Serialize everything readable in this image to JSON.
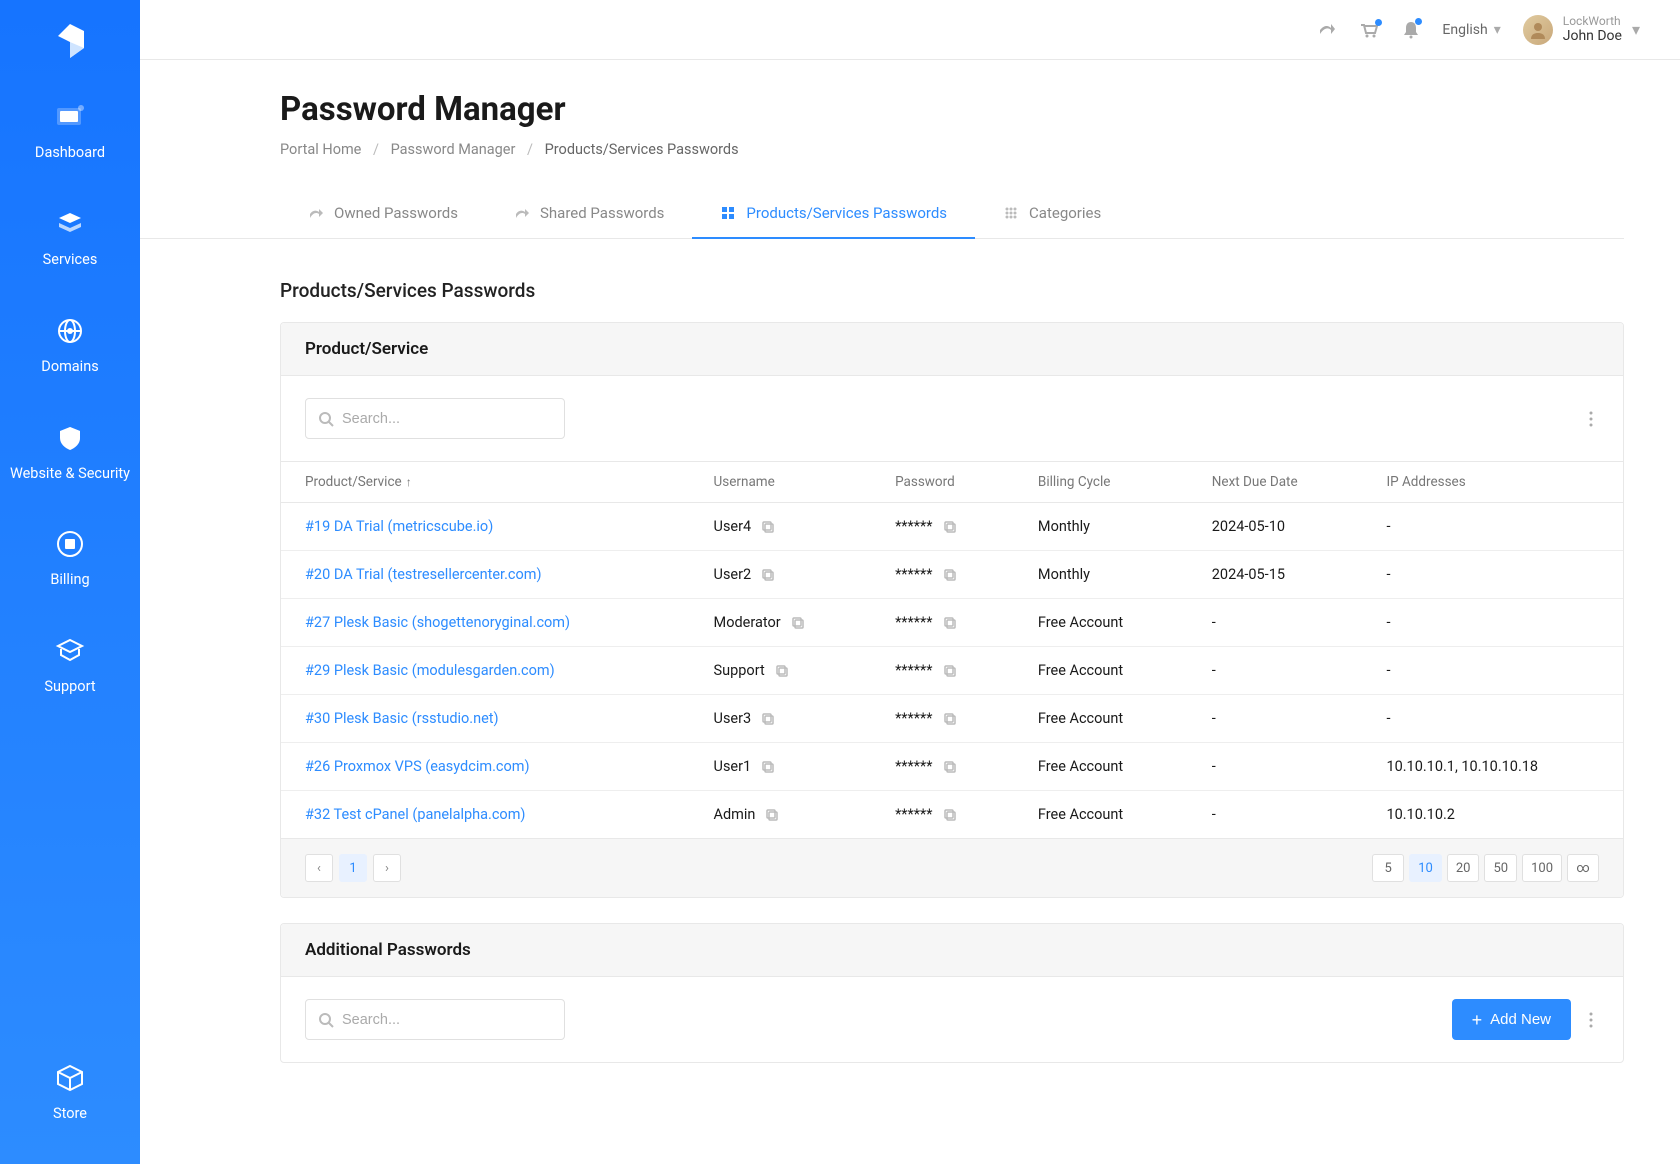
{
  "header": {
    "language": "English",
    "user": {
      "org": "LockWorth",
      "name": "John Doe"
    }
  },
  "sidebar": {
    "items": [
      {
        "label": "Dashboard"
      },
      {
        "label": "Services"
      },
      {
        "label": "Domains"
      },
      {
        "label": "Website & Security"
      },
      {
        "label": "Billing"
      },
      {
        "label": "Support"
      }
    ],
    "store": {
      "label": "Store"
    }
  },
  "page": {
    "title": "Password Manager",
    "breadcrumb": {
      "home": "Portal Home",
      "mid": "Password Manager",
      "current": "Products/Services Passwords"
    },
    "section_title": "Products/Services Passwords"
  },
  "tabs": [
    {
      "label": "Owned Passwords"
    },
    {
      "label": "Shared Passwords"
    },
    {
      "label": "Products/Services Passwords"
    },
    {
      "label": "Categories"
    }
  ],
  "panel": {
    "header": "Product/Service",
    "search_placeholder": "Search...",
    "columns": {
      "product": "Product/Service",
      "username": "Username",
      "password": "Password",
      "cycle": "Billing Cycle",
      "due": "Next Due Date",
      "ip": "IP Addresses"
    }
  },
  "rows": [
    {
      "product": "#19 DA Trial (metricscube.io)",
      "username": "User4",
      "password": "******",
      "cycle": "Monthly",
      "due": "2024-05-10",
      "ip": "-"
    },
    {
      "product": "#20 DA Trial (testresellercenter.com)",
      "username": "User2",
      "password": "******",
      "cycle": "Monthly",
      "due": "2024-05-15",
      "ip": "-"
    },
    {
      "product": "#27 Plesk Basic (shogettenoryginal.com)",
      "username": "Moderator",
      "password": "******",
      "cycle": "Free Account",
      "due": "-",
      "ip": "-"
    },
    {
      "product": "#29 Plesk Basic (modulesgarden.com)",
      "username": "Support",
      "password": "******",
      "cycle": "Free Account",
      "due": "-",
      "ip": "-"
    },
    {
      "product": "#30 Plesk Basic (rsstudio.net)",
      "username": "User3",
      "password": "******",
      "cycle": "Free Account",
      "due": "-",
      "ip": "-"
    },
    {
      "product": "#26 Proxmox VPS (easydcim.com)",
      "username": "User1",
      "password": "******",
      "cycle": "Free Account",
      "due": "-",
      "ip": "10.10.10.1, 10.10.10.18"
    },
    {
      "product": "#32 Test cPanel (panelalpha.com)",
      "username": "Admin",
      "password": "******",
      "cycle": "Free Account",
      "due": "-",
      "ip": "10.10.10.2"
    }
  ],
  "pagination": {
    "current_page": "1",
    "sizes": [
      "5",
      "10",
      "20",
      "50",
      "100",
      "∞"
    ],
    "active_size": "10"
  },
  "additional": {
    "header": "Additional Passwords",
    "search_placeholder": "Search...",
    "add_button": "Add New"
  }
}
